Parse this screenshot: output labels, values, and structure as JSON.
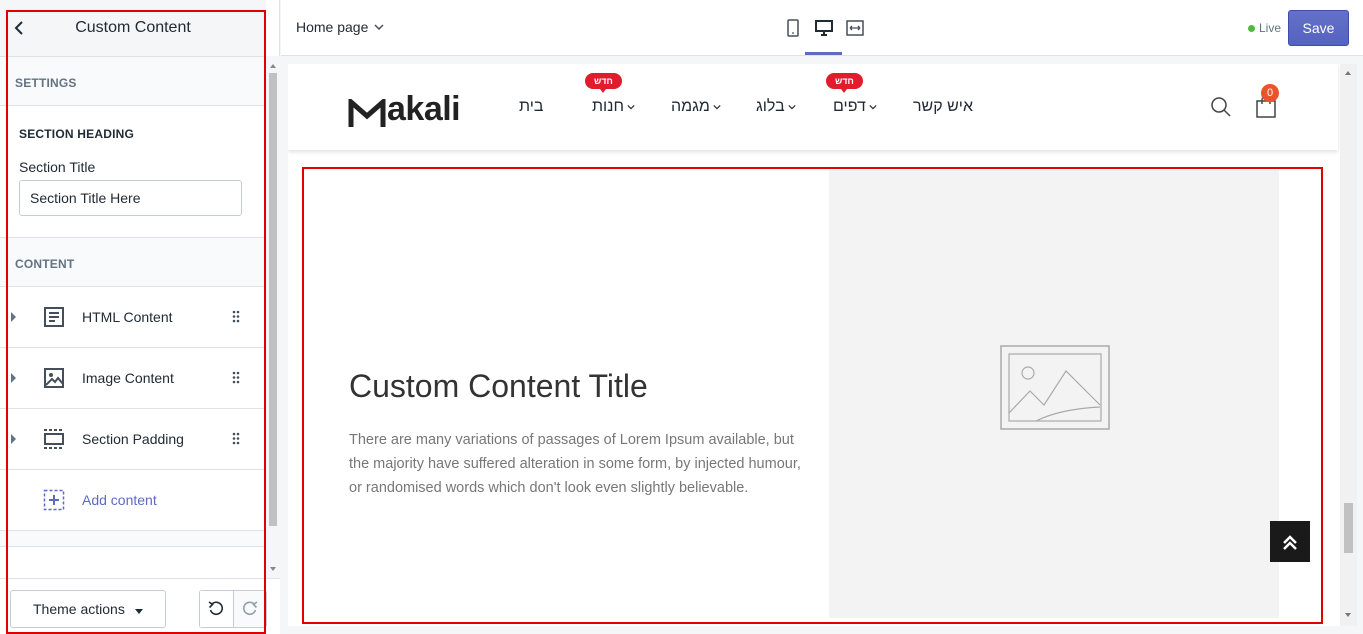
{
  "sidebar": {
    "title": "Custom Content",
    "settings_group": "SETTINGS",
    "section_heading": "SECTION HEADING",
    "section_title_label": "Section Title",
    "section_title_value": "Section Title Here",
    "content_group": "CONTENT",
    "items": [
      {
        "label": "HTML Content",
        "icon": "text-block-icon"
      },
      {
        "label": "Image Content",
        "icon": "image-icon"
      },
      {
        "label": "Section Padding",
        "icon": "padding-icon"
      }
    ],
    "add_content": "Add content",
    "theme_actions": "Theme actions"
  },
  "topbar": {
    "page_select": "Home page",
    "live_label": "Live",
    "save_label": "Save",
    "views": [
      "mobile-view-icon",
      "desktop-view-icon",
      "fullwidth-view-icon"
    ],
    "active_view": "desktop-view-icon"
  },
  "store": {
    "logo": "akali",
    "nav": [
      "בית",
      "חנות",
      "מגמה",
      "בלוג",
      "דפים",
      "איש קשר"
    ],
    "badges": [
      "חדש",
      "חדש"
    ],
    "cart_count": "0"
  },
  "content": {
    "title": "Custom Content Title",
    "text": "There are many variations of passages of Lorem Ipsum available, but the majority have suffered alteration in some form, by injected humour, or randomised words which don't look even slightly believable."
  },
  "colors": {
    "accent": "#5c6ac4",
    "badge": "#e11d2d",
    "outline": "#e00000",
    "live": "#50b83c"
  }
}
